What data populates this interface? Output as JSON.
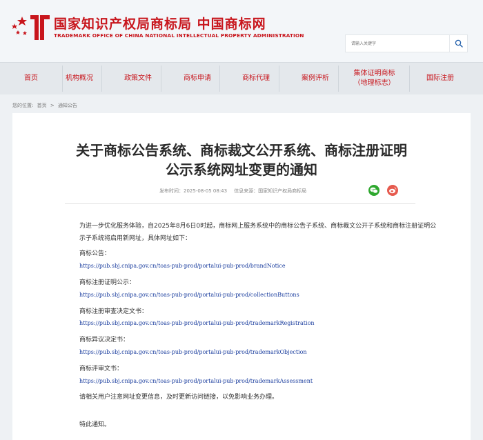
{
  "header": {
    "title": "国家知识产权局商标局 中国商标网",
    "subtitle": "TRADEMARK OFFICE OF CHINA NATIONAL INTELLECTUAL PROPERTY ADMINISTRATION",
    "search_placeholder": "请输入关键字"
  },
  "nav": {
    "items": [
      "首页",
      "机构概况",
      "政策文件",
      "商标申请",
      "商标代理",
      "案例评析",
      "集体证明商标\n（地理标志）",
      "国际注册"
    ]
  },
  "breadcrumb": {
    "prefix": "您的位置:",
    "home": "首页",
    "sep": ">",
    "current": "通知公告"
  },
  "article": {
    "title_line1": "关于商标公告系统、商标裁文公开系统、商标注册证明",
    "title_line2": "公示系统网址变更的通知",
    "publish_label": "发布时间：",
    "publish_time": "2025-08-05 08:43",
    "source_label": "信息来源：",
    "source": "国家知识产权局商标局",
    "intro": "为进一步优化服务体验，自2025年8月6日0时起，商标网上服务系统中的商标公告子系统、商标裁文公开子系统和商标注册证明公示子系统将启用新网址，具体网址如下：",
    "entries": [
      {
        "label": "商标公告：",
        "url": "https://pub.sbj.cnipa.gov.cn/toas-pub-prod/portalui-pub-prod/brandNotice"
      },
      {
        "label": "商标注册证明公示：",
        "url": "https://pub.sbj.cnipa.gov.cn/toas-pub-prod/portalui-pub-prod/collectionButtons"
      },
      {
        "label": "商标注册审查决定文书：",
        "url": "https://pub.sbj.cnipa.gov.cn/toas-pub-prod/portalui-pub-prod/trademarkRegistration"
      },
      {
        "label": "商标异议决定书：",
        "url": "https://pub.sbj.cnipa.gov.cn/toas-pub-prod/portalui-pub-prod/trademarkObjection"
      },
      {
        "label": "商标评审文书：",
        "url": "https://pub.sbj.cnipa.gov.cn/toas-pub-prod/portalui-pub-prod/trademarkAssessment"
      }
    ],
    "notice": "请相关用户注意网址变更信息，及时更新访问链接，以免影响业务办理。",
    "closing": "特此通知。"
  },
  "icons": {
    "logo": "cnipa-logo",
    "search": "search-icon",
    "share": [
      "wechat-icon",
      "weibo-icon"
    ]
  },
  "colors": {
    "brand_red": "#c8161d",
    "link_blue": "#1a3d9e"
  }
}
